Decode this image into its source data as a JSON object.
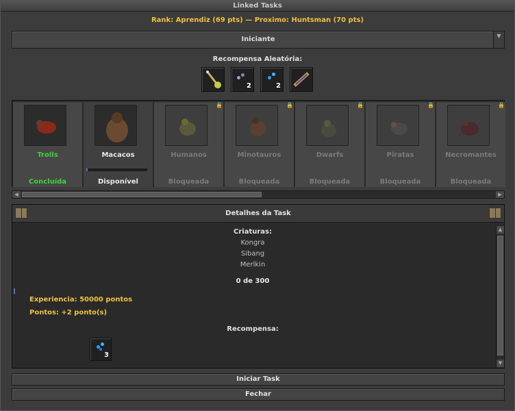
{
  "window": {
    "title": "Linked Tasks"
  },
  "rank_text": "Rank: Aprendiz (69 pts) — Proximo: Huntsman (70 pts)",
  "difficulty": {
    "selected": "Iniciante"
  },
  "random_reward": {
    "label": "Recompensa Aleatória:",
    "items": [
      {
        "icon": "scepter-icon",
        "count": ""
      },
      {
        "icon": "gray-orbs-icon",
        "count": "2"
      },
      {
        "icon": "blue-orbs-icon",
        "count": "2"
      },
      {
        "icon": "scroll-icon",
        "count": ""
      }
    ]
  },
  "creatures": [
    {
      "name": "Trolls",
      "status": "Concluída",
      "locked": false,
      "name_color": "#3ed23e",
      "status_color": "#3ed23e"
    },
    {
      "name": "Macacos",
      "status": "Disponível",
      "locked": false,
      "name_color": "#e8e8e8",
      "status_color": "#e8e8e8",
      "progress": 0.0
    },
    {
      "name": "Humanos",
      "status": "Bloqueada",
      "locked": true
    },
    {
      "name": "Minotauros",
      "status": "Bloqueada",
      "locked": true
    },
    {
      "name": "Dwarfs",
      "status": "Bloqueada",
      "locked": true
    },
    {
      "name": "Piratas",
      "status": "Bloqueada",
      "locked": true
    },
    {
      "name": "Necromantes",
      "status": "Bloqueada",
      "locked": true
    }
  ],
  "details": {
    "title": "Detalhes da Task",
    "creatures_label": "Criaturas:",
    "creature_list": [
      "Kongra",
      "Sibang",
      "Merlkin"
    ],
    "progress_text": "0 de 300",
    "experience": "Experiencia: 50000 pontos",
    "points": "Pontos: +2 ponto(s)",
    "reward_label": "Recompensa:",
    "reward_item": {
      "icon": "blue-orbs-icon",
      "count": "3"
    }
  },
  "buttons": {
    "start": "Iniciar Task",
    "close": "Fechar"
  }
}
